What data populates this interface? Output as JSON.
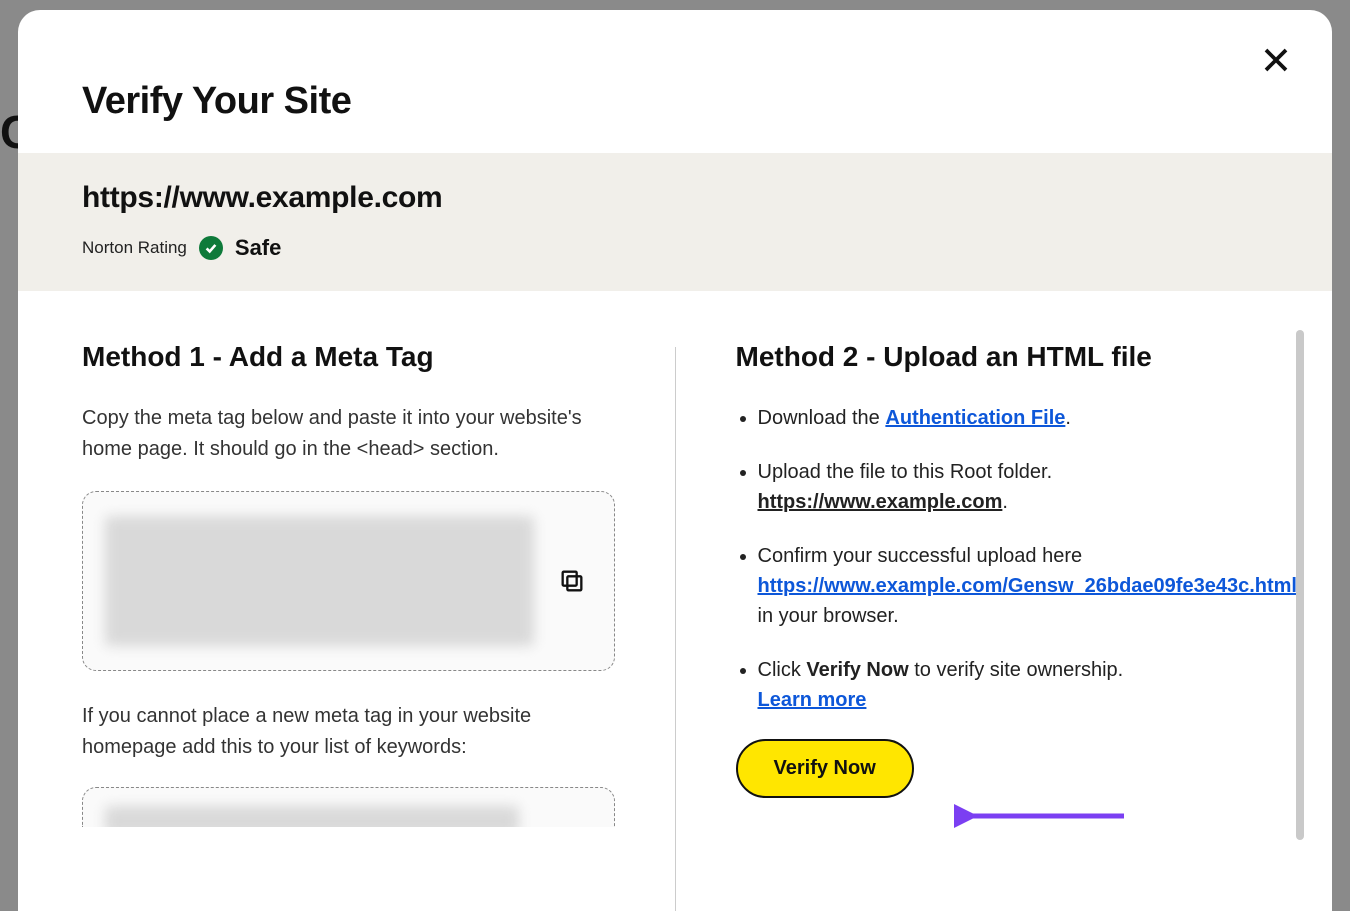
{
  "modal": {
    "title": "Verify Your Site",
    "close_aria": "Close"
  },
  "site": {
    "url": "https://www.example.com",
    "rating_label": "Norton Rating",
    "rating_value": "Safe"
  },
  "method1": {
    "title": "Method 1 - Add a Meta Tag",
    "instructions": "Copy the meta tag below and paste it into your website's home page. It should go in the <head> section.",
    "fallback_note": "If you cannot place a new meta tag in your website homepage add this to your list of keywords:"
  },
  "method2": {
    "title": "Method 2 - Upload an HTML file",
    "step1_prefix": "Download the ",
    "auth_file_link": "Authentication File",
    "step1_suffix": ".",
    "step2_prefix": "Upload the file to this Root folder. ",
    "root_url": "https://www.example.com",
    "step2_suffix": ".",
    "step3_prefix": "Confirm your successful upload here ",
    "confirm_url": "https://www.example.com/Gensw_26bdae09fe3e43c.html",
    "step3_suffix": " in your browser.",
    "step4_prefix": "Click ",
    "step4_bold": "Verify Now",
    "step4_suffix": " to verify site ownership. ",
    "learn_more": "Learn more",
    "verify_button": "Verify Now"
  }
}
